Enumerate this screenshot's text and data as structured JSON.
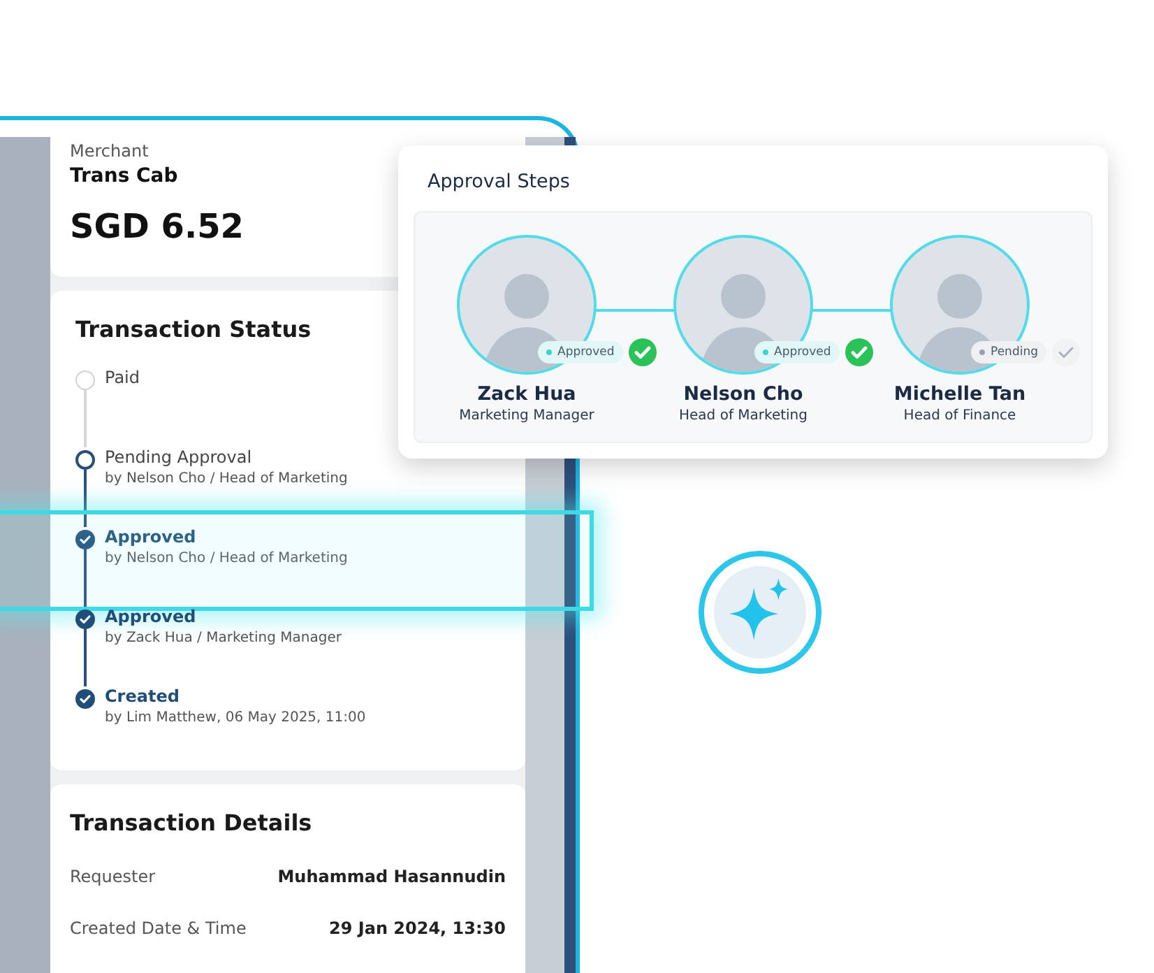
{
  "merchant": {
    "label": "Merchant",
    "name": "Trans Cab",
    "amount": "SGD 6.52"
  },
  "transaction_status": {
    "title": "Transaction Status",
    "steps": [
      {
        "title": "Paid",
        "kind": "idle",
        "highlighted": false
      },
      {
        "title": "Pending Approval",
        "detail": "by Nelson Cho / Head of Marketing",
        "kind": "current",
        "highlighted": false
      },
      {
        "title": "Approved",
        "detail": "by Nelson Cho / Head of Marketing",
        "kind": "done",
        "highlighted": true
      },
      {
        "title": "Approved",
        "detail": "by Zack Hua / Marketing Manager",
        "kind": "done",
        "highlighted": false
      },
      {
        "title": "Created",
        "detail": "by Lim Matthew, 06 May 2025, 11:00",
        "kind": "done",
        "highlighted": false
      }
    ]
  },
  "transaction_details": {
    "title": "Transaction Details",
    "rows": [
      {
        "label": "Requester",
        "value": "Muhammad Hasannudin"
      },
      {
        "label": "Created Date & Time",
        "value": "29 Jan 2024, 13:30"
      }
    ]
  },
  "approval_steps": {
    "title": "Approval Steps",
    "approvers": [
      {
        "name": "Zack Hua",
        "role": "Marketing Manager",
        "status": "Approved",
        "approved": true
      },
      {
        "name": "Nelson Cho",
        "role": "Head of Marketing",
        "status": "Approved",
        "approved": true
      },
      {
        "name": "Michelle Tan",
        "role": "Head of Finance",
        "status": "Pending",
        "approved": false
      }
    ]
  }
}
